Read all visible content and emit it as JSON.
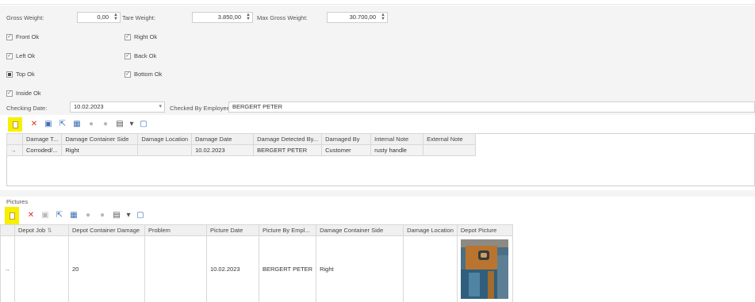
{
  "form": {
    "gross_weight_label": "Gross Weight:",
    "gross_weight_value": "0,00",
    "tare_weight_label": "Tare Weight:",
    "tare_weight_value": "3.850,00",
    "max_gross_weight_label": "Max Gross Weight:",
    "max_gross_weight_value": "30.700,00",
    "checks": [
      {
        "label": "Front Ok",
        "state": "checked"
      },
      {
        "label": "Right Ok",
        "state": "checked"
      },
      {
        "label": "Left Ok",
        "state": "checked"
      },
      {
        "label": "Back Ok",
        "state": "checked"
      },
      {
        "label": "Top Ok",
        "state": "mixed"
      },
      {
        "label": "Bottom Ok",
        "state": "checked"
      },
      {
        "label": "Inside Ok",
        "state": "checked"
      }
    ],
    "checking_date_label": "Checking Date:",
    "checking_date_value": "10.02.2023",
    "checked_by_label": "Checked By Employee:",
    "checked_by_value": "BERGERT PETER"
  },
  "damage_grid": {
    "columns": [
      "Damage T...",
      "Damage Container Side",
      "Damage Location",
      "Damage Date",
      "Damage Detected By...",
      "Damaged By",
      "Internal Note",
      "External Note"
    ],
    "rows": [
      [
        "Corroded/...",
        "Right",
        "",
        "10.02.2023",
        "BERGERT PETER",
        "Customer",
        "rusty handle",
        ""
      ]
    ]
  },
  "pictures": {
    "title": "Pictures",
    "columns": [
      "Depot Job",
      "Depot Container Damage",
      "Problem",
      "Picture Date",
      "Picture By Empl...",
      "Damage Container Side",
      "Damage Location",
      "Depot Picture"
    ],
    "rows": [
      [
        "",
        "20",
        "",
        "10.02.2023",
        "BERGERT PETER",
        "Right",
        "",
        ""
      ]
    ]
  },
  "icons": {
    "row_indicator": "→",
    "check": "✓",
    "delete": "✕",
    "spin_up": "▲",
    "spin_down": "▼",
    "dropdown": "▾"
  },
  "colors": {
    "highlight": "#f6f000",
    "delete_red": "#d8322a",
    "accent_blue": "#3d6fb6"
  }
}
